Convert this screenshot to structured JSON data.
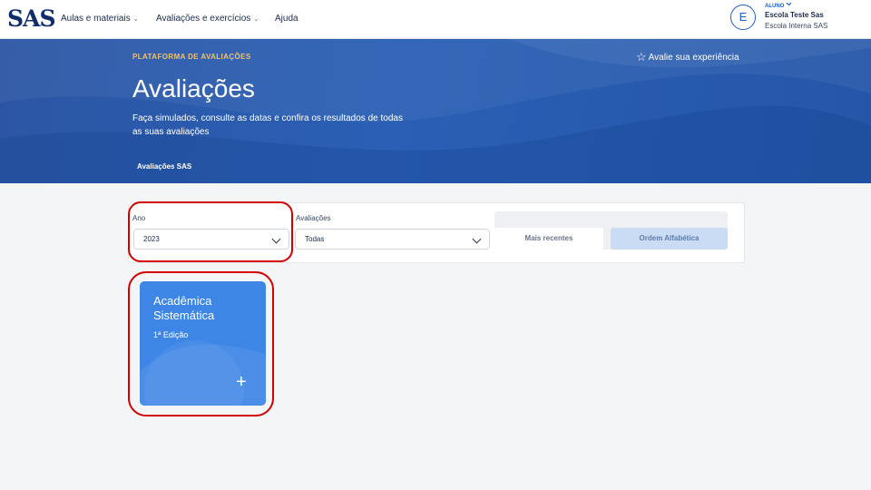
{
  "navbar": {
    "logo": "SAS",
    "menu": [
      {
        "label": "Aulas e materiais",
        "has_dropdown": true
      },
      {
        "label": "Avaliações e exercícios",
        "has_dropdown": true
      },
      {
        "label": "Ajuda",
        "has_dropdown": false
      }
    ],
    "user": {
      "initial": "E",
      "role": "ALUNO",
      "name": "Escola Teste Sas",
      "school": "Escola Interna SAS"
    }
  },
  "hero": {
    "eyebrow": "PLATAFORMA DE AVALIAÇÕES",
    "rate_label": "Avalie sua experiência",
    "title": "Avaliações",
    "subtitle": "Faça simulados, consulte as datas e confira os resultados de todas as suas avaliações",
    "tab": "Avaliações SAS"
  },
  "filters": {
    "year_label": "Ano",
    "year_value": "2023",
    "exams_label": "Avaliações",
    "exams_value": "Todas",
    "sort_recent": "Mais recentes",
    "sort_alpha": "Ordem Alfabética",
    "selected_sort": "Ordem Alfabética"
  },
  "exam_cards": [
    {
      "title": "Acadêmica Sistemática",
      "edition": "1ª Edição"
    }
  ],
  "colors": {
    "hero": "#2a5fb5",
    "eyebrow": "#f2c26b",
    "card": "#3e86e6",
    "selected_sort": "#c9dcf3",
    "annotation": "#d40000"
  }
}
